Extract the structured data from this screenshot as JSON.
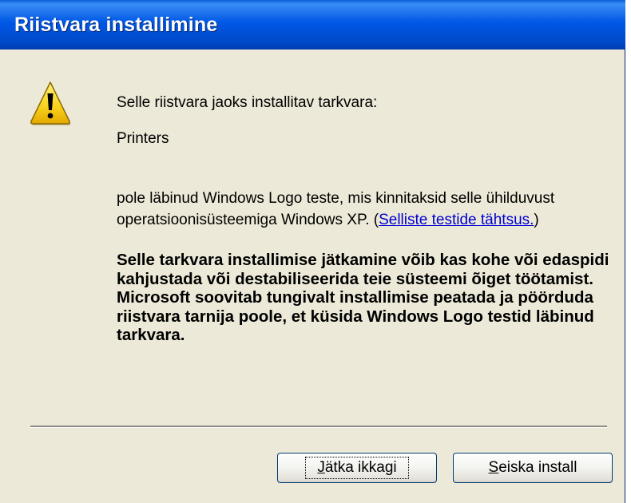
{
  "window": {
    "title": "Riistvara installimine"
  },
  "content": {
    "intro": "Selle riistvara jaoks installitav tarkvara:",
    "device": "Printers",
    "paragraph_line1": "pole läbinud Windows Logo teste, mis kinnitaksid selle ühilduvust",
    "paragraph_line2_before": "operatsioonisüsteemiga Windows XP. (",
    "link_text": "Selliste testide tähtsus.",
    "paragraph_line2_after": ")",
    "warning": "Selle tarkvara installimise jätkamine võib kas kohe või edaspidi kahjustada või destabiliseerida teie süsteemi õiget töötamist. Microsoft soovitab tungivalt installimise peatada ja pöörduda riistvara tarnija poole, et küsida Windows Logo testid läbinud tarkvara."
  },
  "buttons": {
    "continue_mnemonic": "J",
    "continue_rest": "ätka ikkagi",
    "stop_mnemonic": "S",
    "stop_rest": "eiska install"
  },
  "icons": {
    "warning": "warning-icon"
  },
  "colors": {
    "titlebar": "#0058e6",
    "background": "#ece9d8",
    "link": "#0000d0"
  }
}
